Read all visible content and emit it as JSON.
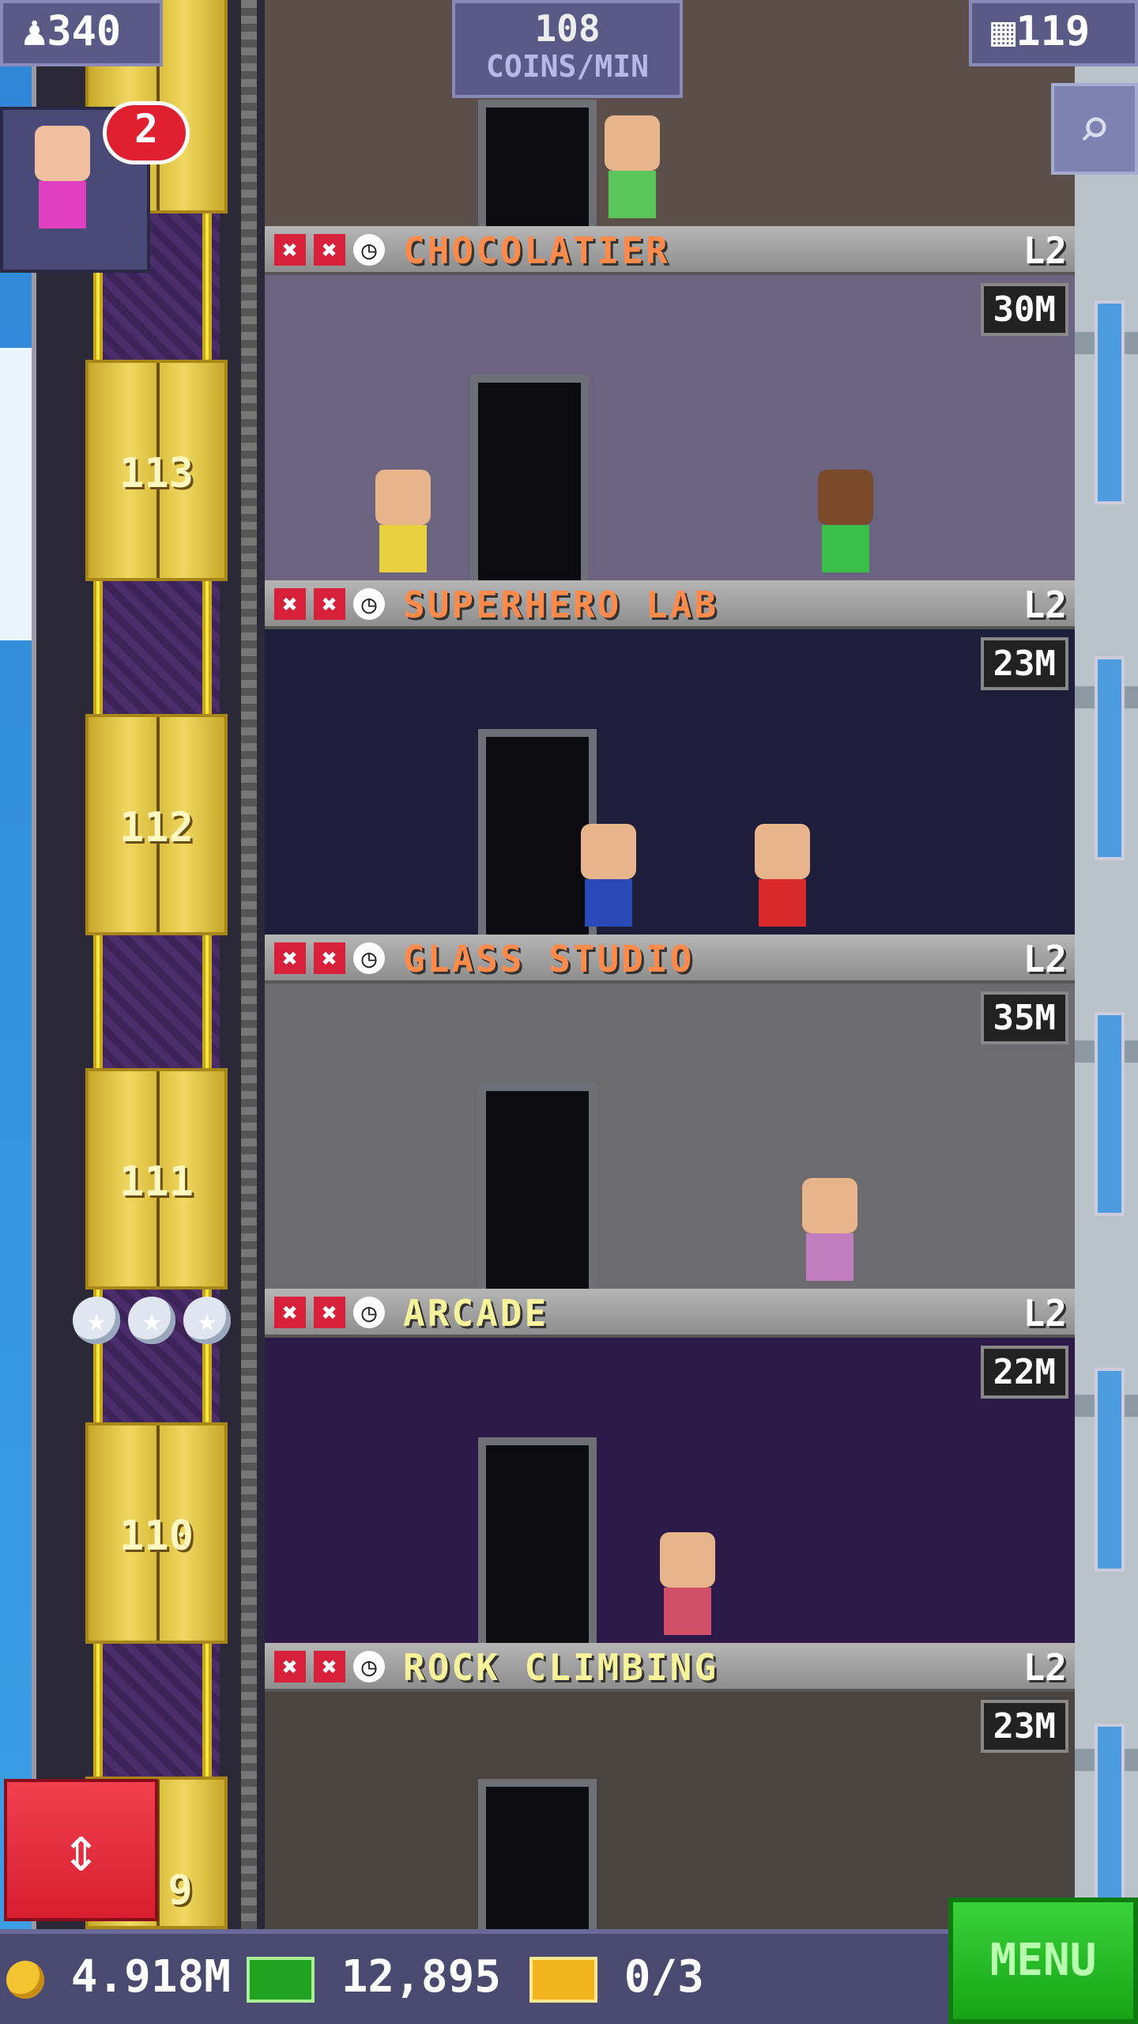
{
  "hud": {
    "population": "340",
    "coins_rate_value": "108",
    "coins_rate_unit": "COINS/MIN",
    "floors": "119"
  },
  "vip": {
    "badge_count": "2"
  },
  "elevator": {
    "doors": [
      "113",
      "112",
      "111",
      "110",
      "9"
    ],
    "stars": [
      "★",
      "★",
      "★"
    ]
  },
  "floors": [
    {
      "name": "CHOCOLATIER",
      "level": "L2",
      "time": "30M",
      "name_color": "#ff8a4a",
      "room_color": "#6b6480"
    },
    {
      "name": "SUPERHERO LAB",
      "level": "L2",
      "time": "23M",
      "name_color": "#ff8a4a",
      "room_color": "#1e1e3a"
    },
    {
      "name": "GLASS STUDIO",
      "level": "L2",
      "time": "35M",
      "name_color": "#ff8a4a",
      "room_color": "#6c6c6e"
    },
    {
      "name": "ARCADE",
      "level": "L2",
      "time": "22M",
      "name_color": "#f6f29a",
      "room_color": "#2c1a48"
    },
    {
      "name": "ROCK CLIMBING",
      "level": "L2",
      "time": "23M",
      "name_color": "#f6f29a",
      "room_color": "#4a4440"
    }
  ],
  "status_icons": {
    "x": "✖",
    "clock": "◷"
  },
  "bottom": {
    "coins": "4.918M",
    "bux": "12,895",
    "tickets": "0/3",
    "menu_label": "MENU"
  },
  "icons": {
    "population": "person-icon",
    "floors": "building-icon",
    "search": "magnifier-icon",
    "updown": "up-down-arrows-icon",
    "coin": "coin-icon",
    "bux": "bux-icon",
    "ticket": "ticket-icon"
  }
}
